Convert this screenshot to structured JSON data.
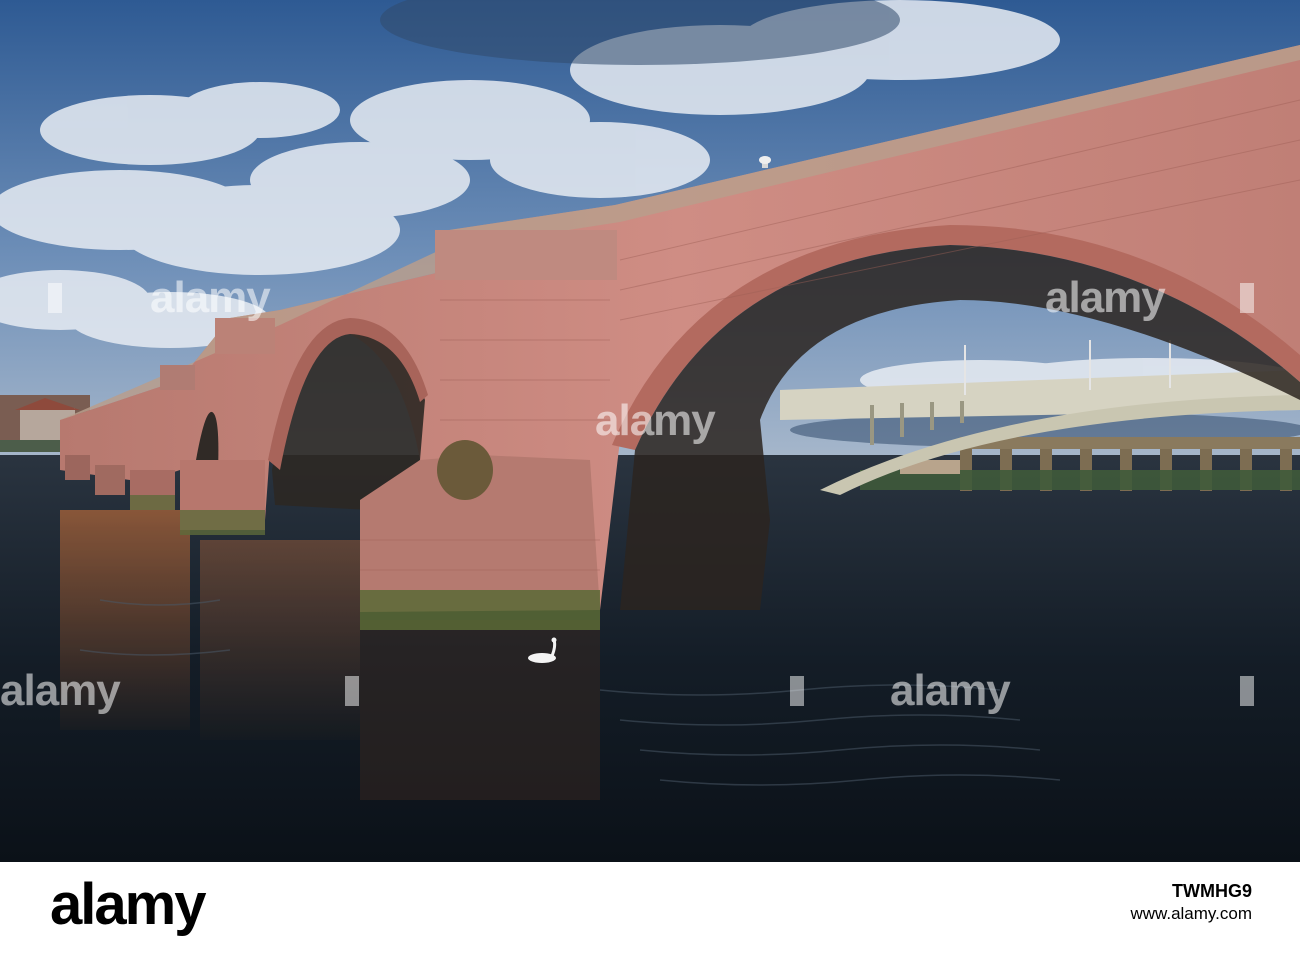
{
  "image": {
    "subject": "old sandstone arched bridge over river with modern road bridge and railway viaduct behind, swan on water",
    "colors": {
      "sky": "#3f6aa3",
      "cloud": "#e6ebf2",
      "stone": "#c7807a",
      "water": "#17212c",
      "viaduct": "#8a7a5e"
    }
  },
  "watermark": {
    "brand": "alamy"
  },
  "footer": {
    "logo": "alamy",
    "image_id": "TWMHG9",
    "site": "www.alamy.com"
  }
}
